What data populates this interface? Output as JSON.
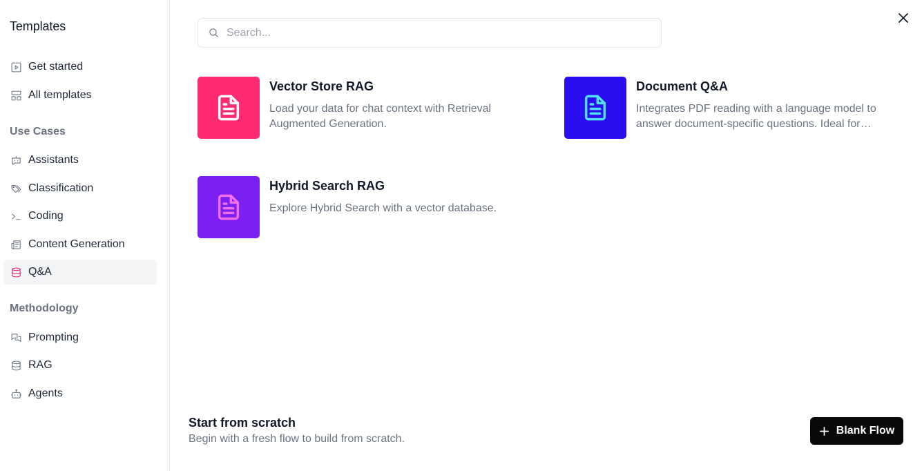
{
  "sidebar": {
    "title": "Templates",
    "top_items": [
      {
        "label": "Get started",
        "icon": "play-square-icon"
      },
      {
        "label": "All templates",
        "icon": "layout-grid-icon"
      }
    ],
    "use_cases": {
      "heading": "Use Cases",
      "items": [
        {
          "label": "Assistants",
          "icon": "bot-message-icon"
        },
        {
          "label": "Classification",
          "icon": "tags-icon"
        },
        {
          "label": "Coding",
          "icon": "terminal-icon"
        },
        {
          "label": "Content Generation",
          "icon": "newspaper-icon"
        },
        {
          "label": "Q&A",
          "icon": "database-icon",
          "active": true
        }
      ]
    },
    "methodology": {
      "heading": "Methodology",
      "items": [
        {
          "label": "Prompting",
          "icon": "messages-icon"
        },
        {
          "label": "RAG",
          "icon": "database-icon"
        },
        {
          "label": "Agents",
          "icon": "bot-icon"
        }
      ]
    }
  },
  "search": {
    "placeholder": "Search...",
    "value": ""
  },
  "templates": [
    {
      "title": "Vector Store RAG",
      "description": "Load your data for chat context with Retrieval Augmented Generation.",
      "icon": "file-text-icon",
      "bg": "#fe2a74",
      "icon_color": "#ffffff"
    },
    {
      "title": "Document Q&A",
      "description": "Integrates PDF reading with a language model to answer document-specific questions. Ideal for…",
      "icon": "file-text-icon",
      "bg": "#2b0ef0",
      "icon_color": "#4fe0f5"
    },
    {
      "title": "Hybrid Search RAG",
      "description": "Explore Hybrid Search with a vector database.",
      "icon": "file-text-icon",
      "bg": "#7b1ff2",
      "icon_color": "#f06fe8"
    }
  ],
  "footer": {
    "title": "Start from scratch",
    "subtitle": "Begin with a fresh flow to build from scratch.",
    "button_label": "Blank Flow"
  }
}
